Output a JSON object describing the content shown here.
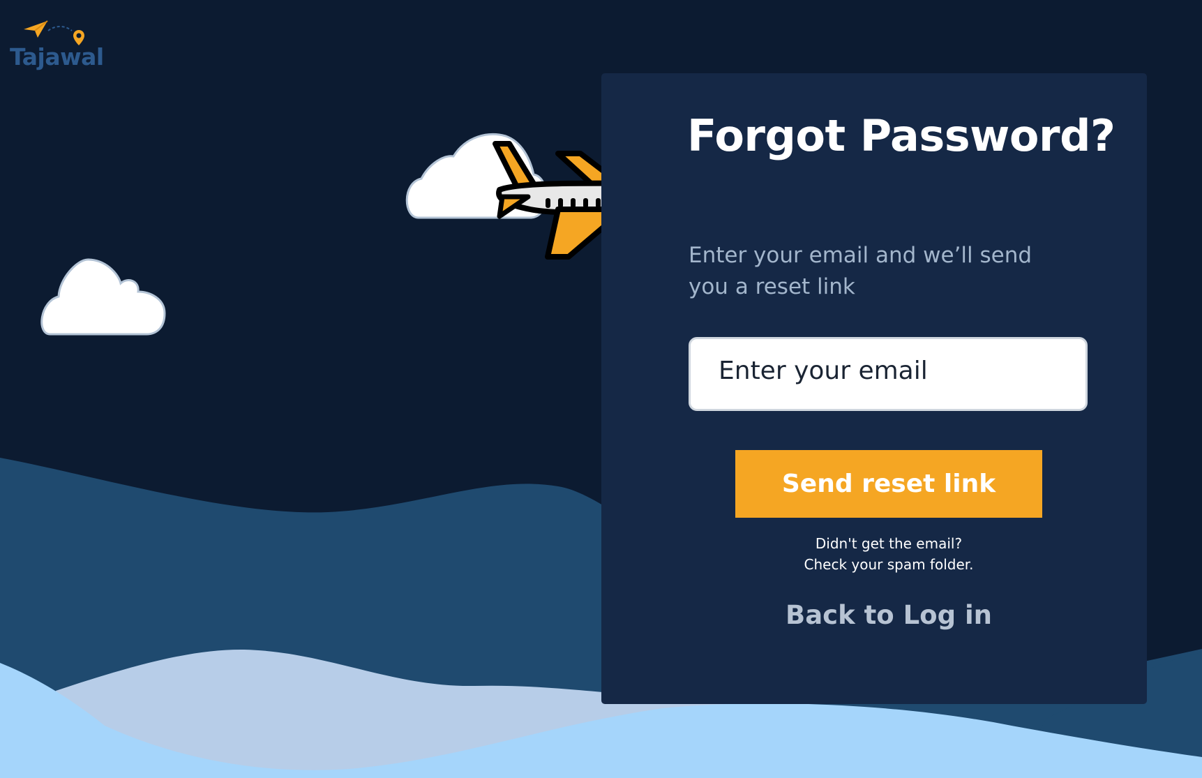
{
  "brand": {
    "name": "Tajawal",
    "logo_icon": "paper-plane-icon",
    "pin_icon": "map-pin-icon",
    "accent_color": "#f5a623",
    "text_color": "#2d5a8e"
  },
  "form": {
    "title": "Forgot Password?",
    "subtitle": "Enter your email and we’ll send you a reset link",
    "email_placeholder": "Enter your email",
    "email_value": "",
    "submit_label": "Send reset link",
    "hint_line_1": "Didn't get the email?",
    "hint_line_2": "Check your spam folder.",
    "back_link": "Back to Log in"
  },
  "decor": {
    "airplane_icon": "airplane-icon",
    "cloud_icon": "cloud-icon"
  },
  "colors": {
    "background": "#0c1b31",
    "card": "#152846",
    "button": "#f5a623",
    "wave_mid": "#1f4a6f",
    "wave_light": "#b7cde8",
    "wave_lightest": "#a5d5fb"
  }
}
